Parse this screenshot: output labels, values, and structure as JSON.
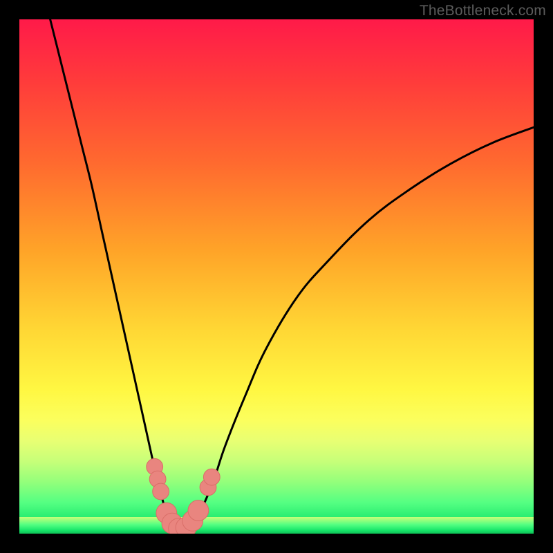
{
  "watermark": "TheBottleneck.com",
  "colors": {
    "frame": "#000000",
    "curve": "#000000",
    "marker_fill": "#e9857f",
    "marker_stroke": "#d96e68",
    "gradient_stops": [
      "#ff1a49",
      "#ff3b3b",
      "#ff6a2f",
      "#ffa428",
      "#ffd634",
      "#fff742",
      "#fbff5e",
      "#e8ff73",
      "#c6ff79",
      "#93ff7b",
      "#54ff82",
      "#17e66a",
      "#0fbf55"
    ]
  },
  "chart_data": {
    "type": "line",
    "title": "",
    "xlabel": "",
    "ylabel": "",
    "xlim": [
      0,
      100
    ],
    "ylim": [
      0,
      100
    ],
    "grid": false,
    "legend": false,
    "series": [
      {
        "name": "bottleneck-curve",
        "x": [
          6,
          8,
          10,
          12,
          14,
          16,
          18,
          20,
          22,
          24,
          26,
          27,
          28,
          29,
          30,
          31,
          32,
          33,
          34,
          35,
          36,
          38,
          40,
          44,
          48,
          54,
          60,
          68,
          76,
          84,
          92,
          100
        ],
        "y": [
          100,
          92,
          84,
          76,
          68,
          59,
          50,
          41,
          32,
          23,
          14,
          10,
          6,
          3,
          1.5,
          1,
          1,
          1.5,
          2.5,
          4,
          6,
          11,
          17,
          27,
          36,
          46,
          53,
          61,
          67,
          72,
          76,
          79
        ]
      }
    ],
    "markers": [
      {
        "x": 26.3,
        "y": 13.0,
        "r": 1.6
      },
      {
        "x": 26.9,
        "y": 10.6,
        "r": 1.6
      },
      {
        "x": 27.5,
        "y": 8.2,
        "r": 1.6
      },
      {
        "x": 28.6,
        "y": 4.0,
        "r": 2.0
      },
      {
        "x": 29.7,
        "y": 2.0,
        "r": 2.0
      },
      {
        "x": 31.0,
        "y": 1.0,
        "r": 2.0
      },
      {
        "x": 32.4,
        "y": 1.2,
        "r": 2.0
      },
      {
        "x": 33.7,
        "y": 2.5,
        "r": 2.0
      },
      {
        "x": 34.8,
        "y": 4.5,
        "r": 2.0
      },
      {
        "x": 36.7,
        "y": 9.0,
        "r": 1.6
      },
      {
        "x": 37.4,
        "y": 11.0,
        "r": 1.6
      }
    ]
  }
}
